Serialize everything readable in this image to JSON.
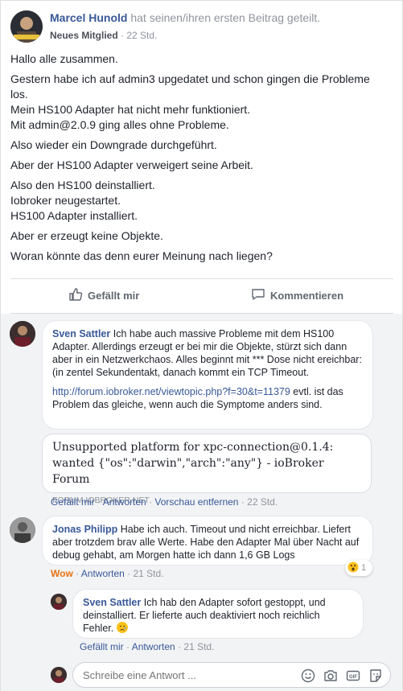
{
  "post": {
    "author": "Marcel Hunold",
    "action": " hat seinen/ihren ersten Beitrag geteilt.",
    "badge": "Neues Mitglied",
    "time": " · 22 Std.",
    "paragraphs": [
      "Hallo alle zusammen.",
      "Gestern habe ich auf admin3 upgedatet und schon gingen die Probleme los.",
      "Mein HS100 Adapter hat nicht mehr funktioniert.",
      "Mit admin@2.0.9 ging alles ohne Probleme.",
      "Also wieder ein Downgrade durchgeführt.",
      "Aber der HS100 Adapter verweigert seine Arbeit.",
      "Also den HS100 deinstalliert.",
      "Iobroker neugestartet.",
      "HS100 Adapter installiert.",
      "Aber er erzeugt keine Objekte.",
      "Woran könnte das denn eurer Meinung nach liegen?"
    ]
  },
  "actions": {
    "like": "Gefällt mir",
    "comment": "Kommentieren"
  },
  "comments": [
    {
      "author": "Sven Sattler",
      "text": " Ich habe auch massive Probleme mit dem HS100 Adapter. Allerdings erzeugt er bei mir die Objekte, stürzt sich dann aber in ein Netzwerkchaos. Alles beginnt mit *** Dose nicht ereichbar: (in zentel Sekundentakt, danach kommt ein TCP Timeout.",
      "link": "http://forum.iobroker.net/viewtopic.php?f=30&t=11379",
      "link_after": " evtl. ist das Problem das gleiche, wenn auch die Symptome anders sind.",
      "preview_title": "Unsupported platform for xpc-connection@0.1.4: wanted {\"os\":\"darwin\",\"arch\":\"any\"} - ioBroker Forum",
      "preview_domain": "FORUM.IOBROKER.NET",
      "like": "Gefällt mir",
      "reply": "Antworten",
      "remove_preview": "Vorschau entfernen",
      "time": "22 Std."
    },
    {
      "author": "Jonas Philipp",
      "text": " Habe ich auch. Timeout und nicht erreichbar. Liefert aber trotzdem brav alle Werte. Habe den Adapter Mal über Nacht auf debug gehabt, am Morgen hatte ich dann 1,6 GB Logs",
      "reaction_label": "Wow",
      "reply": "Antworten",
      "time": "21 Std.",
      "reaction_count": "1"
    },
    {
      "author": "Sven Sattler",
      "text": " Ich hab den Adapter sofort gestoppt, und deinstalliert. Er lieferte auch deaktiviert noch reichlich Fehler.",
      "like": "Gefällt mir",
      "reply": "Antworten",
      "time": "21 Std."
    }
  ],
  "compose": {
    "placeholder": "Schreibe eine Antwort ..."
  },
  "icons": [
    "thumbs-up-icon",
    "comment-icon",
    "smiley-icon",
    "camera-icon",
    "gif-icon",
    "sticker-icon"
  ],
  "colors": {
    "link": "#385898",
    "muted": "#90949c",
    "wow": "#e9710f",
    "comments_bg": "#f2f3f5"
  }
}
